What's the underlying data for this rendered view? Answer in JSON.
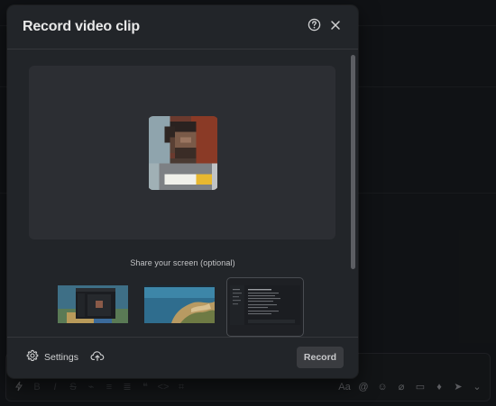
{
  "modal": {
    "title": "Record video clip",
    "help_icon": "question-circle-icon",
    "close_icon": "close-icon"
  },
  "preview": {
    "camera_feed": "pixelated-face-preview"
  },
  "share": {
    "label": "Share your screen (optional)",
    "options": [
      {
        "name": "screen-1"
      },
      {
        "name": "screen-2"
      },
      {
        "name": "window-3"
      }
    ]
  },
  "footer": {
    "settings_label": "Settings",
    "settings_icon": "gear-icon",
    "upload_icon": "cloud-upload-icon",
    "record_label": "Record"
  },
  "colors": {
    "modal_bg": "#222529",
    "preview_bg": "#2c2e33",
    "record_button_bg": "#3a3c40",
    "page_bg": "#1a1d21"
  }
}
